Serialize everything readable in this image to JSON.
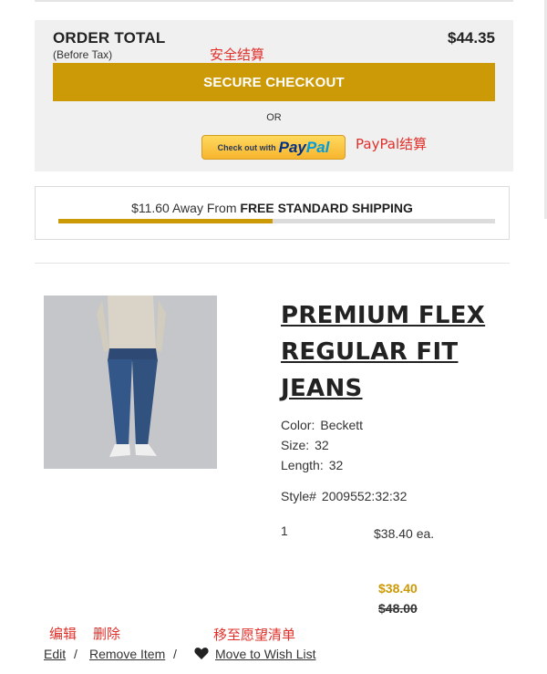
{
  "summary": {
    "order_total_label": "ORDER TOTAL",
    "before_tax_label": "(Before Tax)",
    "amount": "$44.35",
    "secure_checkout_label": "SECURE CHECKOUT",
    "or_label": "OR",
    "paypal_prefix": "Check out with",
    "paypal_pay": "Pay",
    "paypal_pal": "Pal"
  },
  "annotations": {
    "secure_checkout": "安全结算",
    "paypal": "PayPal结算",
    "edit": "编辑",
    "remove": "删除",
    "wishlist": "移至愿望清单"
  },
  "shipping": {
    "away_text": "$11.60 Away From ",
    "free_text": "FREE STANDARD SHIPPING",
    "progress_fraction": 0.49
  },
  "product": {
    "title": "PREMIUM FLEX REGULAR FIT JEANS",
    "color_label": "Color:",
    "color_value": "Beckett",
    "size_label": "Size:",
    "size_value": "32",
    "length_label": "Length:",
    "length_value": "32",
    "style_label": "Style#",
    "style_value": "2009552:32:32",
    "quantity": "1",
    "each_price": "$38.40 ea.",
    "price": "$38.40",
    "original_price": "$48.00"
  },
  "actions": {
    "edit": "Edit",
    "remove": "Remove Item",
    "wishlist": "Move to Wish List",
    "separator": "/"
  },
  "colors": {
    "accent": "#cc9a06",
    "annotation": "#e0302a",
    "panel_bg": "#f0f0f0"
  },
  "icons": {
    "wishlist": "heart-icon"
  }
}
